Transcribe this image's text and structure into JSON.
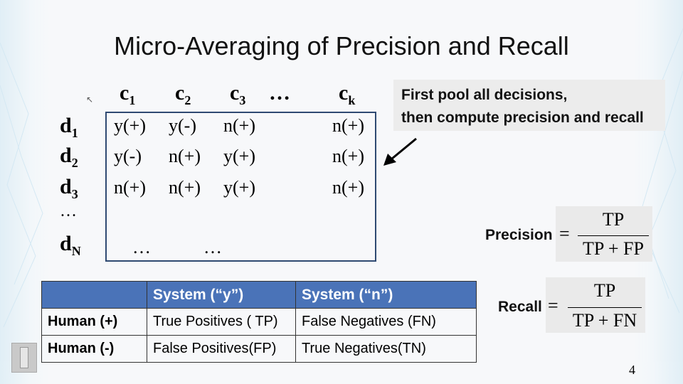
{
  "title": "Micro-Averaging of Precision and Recall",
  "columns": [
    {
      "letter": "c",
      "sub": "1"
    },
    {
      "letter": "c",
      "sub": "2"
    },
    {
      "letter": "c",
      "sub": "3"
    },
    {
      "letter": "…",
      "sub": ""
    },
    {
      "letter": "c",
      "sub": "k"
    }
  ],
  "rows": [
    {
      "letter": "d",
      "sub": "1"
    },
    {
      "letter": "d",
      "sub": "2"
    },
    {
      "letter": "d",
      "sub": "3"
    },
    {
      "letter": "…",
      "sub": ""
    },
    {
      "letter": "d",
      "sub": "N"
    }
  ],
  "matrix": [
    [
      "y(+)",
      "y(-)",
      "n(+)",
      "n(+)"
    ],
    [
      "y(-)",
      "n(+)",
      "y(+)",
      "n(+)"
    ],
    [
      "n(+)",
      "n(+)",
      "y(+)",
      "n(+)"
    ],
    [
      "…",
      "…"
    ]
  ],
  "callout": {
    "line1": "First pool all decisions,",
    "line2": "then compute precision and recall"
  },
  "precision": {
    "label": "Precision",
    "eq": "=",
    "numerator": "TP",
    "denominator": "TP + FP"
  },
  "recall": {
    "label": "Recall",
    "eq": "=",
    "numerator": "TP",
    "denominator": "TP + FN"
  },
  "contingency": {
    "header": [
      "",
      "System (“y”)",
      "System (“n”)"
    ],
    "rows": [
      [
        "Human (+)",
        "True Positives ( TP)",
        "False Negatives (FN)"
      ],
      [
        "Human (-)",
        "False Positives(FP)",
        "True Negatives(TN)"
      ]
    ]
  },
  "page_number": "4"
}
